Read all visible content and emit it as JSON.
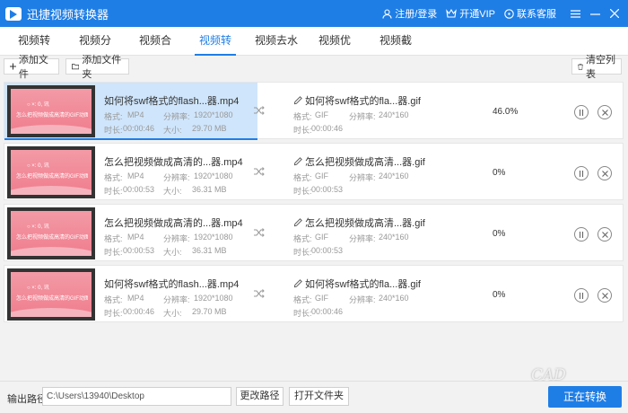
{
  "app": {
    "title": "迅捷视频转换器"
  },
  "header": {
    "login": "注册/登录",
    "vip": "开通VIP",
    "support": "联系客服"
  },
  "tabs": [
    {
      "label": "视频转换"
    },
    {
      "label": "视频分割"
    },
    {
      "label": "视频合并"
    },
    {
      "label": "视频转GIF"
    },
    {
      "label": "视频去水印"
    },
    {
      "label": "视频优化"
    },
    {
      "label": "视频截图"
    }
  ],
  "active_tab": "视频转GIF",
  "toolbar": {
    "add_file": "添加文件",
    "add_folder": "添加文件夹",
    "clear_list": "清空列表"
  },
  "labels": {
    "format": "格式:",
    "resolution": "分辨率:",
    "duration": "时长:",
    "size": "大小:"
  },
  "thumbnail": {
    "caption": "怎么把视频做成高清的GIF动图",
    "tag": "○ ×: 0, 讯"
  },
  "rows": [
    {
      "input_name": "如何将swf格式的flash...器.mp4",
      "input_format": "MP4",
      "input_resolution": "1920*1080",
      "input_duration": "00:00:46",
      "input_size": "29.70 MB",
      "output_name": "如何将swf格式的fla...器.gif",
      "output_format": "GIF",
      "output_resolution": "240*160",
      "output_duration": "00:00:46",
      "progress": "46.0%"
    },
    {
      "input_name": "怎么把视频做成高清的...器.mp4",
      "input_format": "MP4",
      "input_resolution": "1920*1080",
      "input_duration": "00:00:53",
      "input_size": "36.31 MB",
      "output_name": "怎么把视频做成高清...器.gif",
      "output_format": "GIF",
      "output_resolution": "240*160",
      "output_duration": "00:00:53",
      "progress": "0%"
    },
    {
      "input_name": "怎么把视频做成高清的...器.mp4",
      "input_format": "MP4",
      "input_resolution": "1920*1080",
      "input_duration": "00:00:53",
      "input_size": "36.31 MB",
      "output_name": "怎么把视频做成高清...器.gif",
      "output_format": "GIF",
      "output_resolution": "240*160",
      "output_duration": "00:00:53",
      "progress": "0%"
    },
    {
      "input_name": "如何将swf格式的flash...器.mp4",
      "input_format": "MP4",
      "input_resolution": "1920*1080",
      "input_duration": "00:00:46",
      "input_size": "29.70 MB",
      "output_name": "如何将swf格式的fla...器.gif",
      "output_format": "GIF",
      "output_resolution": "240*160",
      "output_duration": "00:00:46",
      "progress": "0%"
    }
  ],
  "bottom": {
    "output_label": "输出路径:",
    "output_path": "C:\\Users\\13940\\Desktop",
    "change_path": "更改路径",
    "open_folder": "打开文件夹",
    "convert": "正在转换"
  },
  "watermark": "CAD",
  "colors": {
    "accent": "#1f7ee6",
    "selected_row": "#cfe5fb",
    "thumb_pink": "#f07d8d"
  },
  "icons": [
    "app-logo-icon",
    "user-icon",
    "vip-icon",
    "support-icon",
    "menu-icon",
    "minimize-icon",
    "close-icon",
    "plus-icon",
    "folder-icon",
    "trash-icon",
    "shuffle-icon",
    "edit-icon",
    "pause-icon",
    "cancel-icon"
  ]
}
